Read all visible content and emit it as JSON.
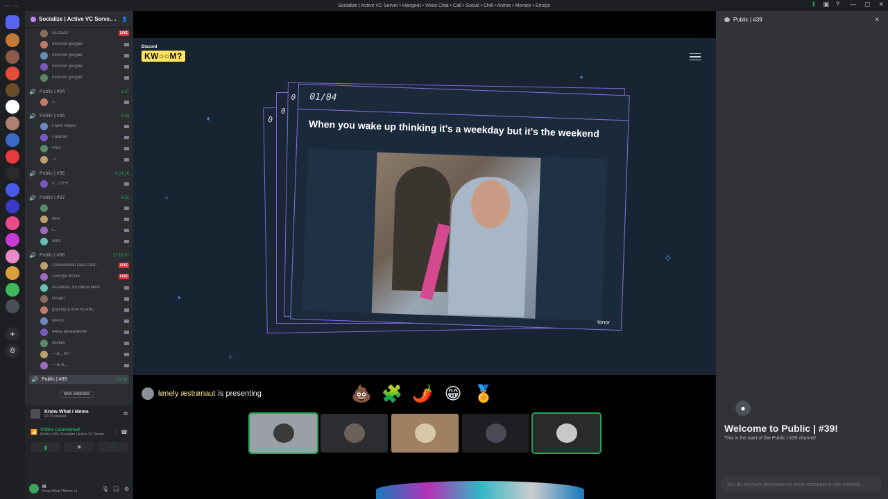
{
  "window": {
    "title": "Socialize | Active VC Server • Hangout • Voice Chat • Call • Social • Chill • Anime • Memes • Emojis"
  },
  "server": {
    "name": "Socialize | Active VC Serve..."
  },
  "channels": [
    {
      "name": "",
      "time": "",
      "members": [
        {
          "name": "ALCIa10",
          "live": true
        },
        {
          "name": "mormon groyper"
        },
        {
          "name": "mormon groyper"
        },
        {
          "name": "mormon groyper"
        },
        {
          "name": "mormon groyper"
        }
      ]
    },
    {
      "name": "Public | #34",
      "time": "1:37",
      "members": [
        {
          "name": "s..."
        }
      ]
    },
    {
      "name": "Public | #35",
      "time": "9:53",
      "members": [
        {
          "name": "Frank Reyes"
        },
        {
          "name": "Futanari"
        },
        {
          "name": "Prior"
        },
        {
          "name": "-ᨀ"
        }
      ]
    },
    {
      "name": "Public | #36",
      "time": "6:24:26",
      "members": [
        {
          "name": "v... LYFE"
        }
      ]
    },
    {
      "name": "Public | #37",
      "time": "8:36",
      "members": [
        {
          "name": "."
        },
        {
          "name": "floor"
        },
        {
          "name": "l..."
        },
        {
          "name": "slam"
        }
      ]
    },
    {
      "name": "Public | #38",
      "time": "27:18:57",
      "members": [
        {
          "name": "Cheetahman (aka Catb...",
          "live": true
        },
        {
          "name": "Zenoryx RAGE",
          "live": true
        },
        {
          "name": "As Above, So Below Nerd"
        },
        {
          "name": "Dream"
        },
        {
          "name": "goyslop (I love it!) ARC"
        },
        {
          "name": "MACK"
        },
        {
          "name": "Meral bestie/Mönlil"
        },
        {
          "name": "Outlaw"
        },
        {
          "name": "~~d... WT"
        },
        {
          "name": "~~d-m..."
        }
      ]
    },
    {
      "name": "Public | #39",
      "time": "21:36",
      "active": true,
      "members": []
    }
  ],
  "new_unreads": "NEW UNREADS",
  "activity_panel": {
    "title": "Know What I Meme",
    "elapsed": "12:23 elapsed",
    "voice_status": "Video Connected",
    "voice_location": "Public | #39 / Socialize | Active VC Server ..."
  },
  "user": {
    "name": "H",
    "status": "Know What I Meme +1"
  },
  "game": {
    "brand_small": "Discord",
    "brand": "KW○○M?",
    "counter": "01/04",
    "back_counters": [
      "0",
      "0",
      "0"
    ],
    "question": "When you wake up thinking it's a weekday but it's the weekend",
    "gif_source": "tenor"
  },
  "presenter": {
    "name": "łønely æstrønaut",
    "suffix": "is presenting"
  },
  "reactions": [
    "💩",
    "🧩",
    "🌶️",
    "😁",
    "🏅"
  ],
  "chat": {
    "title": "Public | #39",
    "welcome_title": "Welcome to Public | #39!",
    "welcome_sub": "This is the start of the Public | #39 channel.",
    "no_permission": "You do not have permission to send messages in this channel."
  }
}
